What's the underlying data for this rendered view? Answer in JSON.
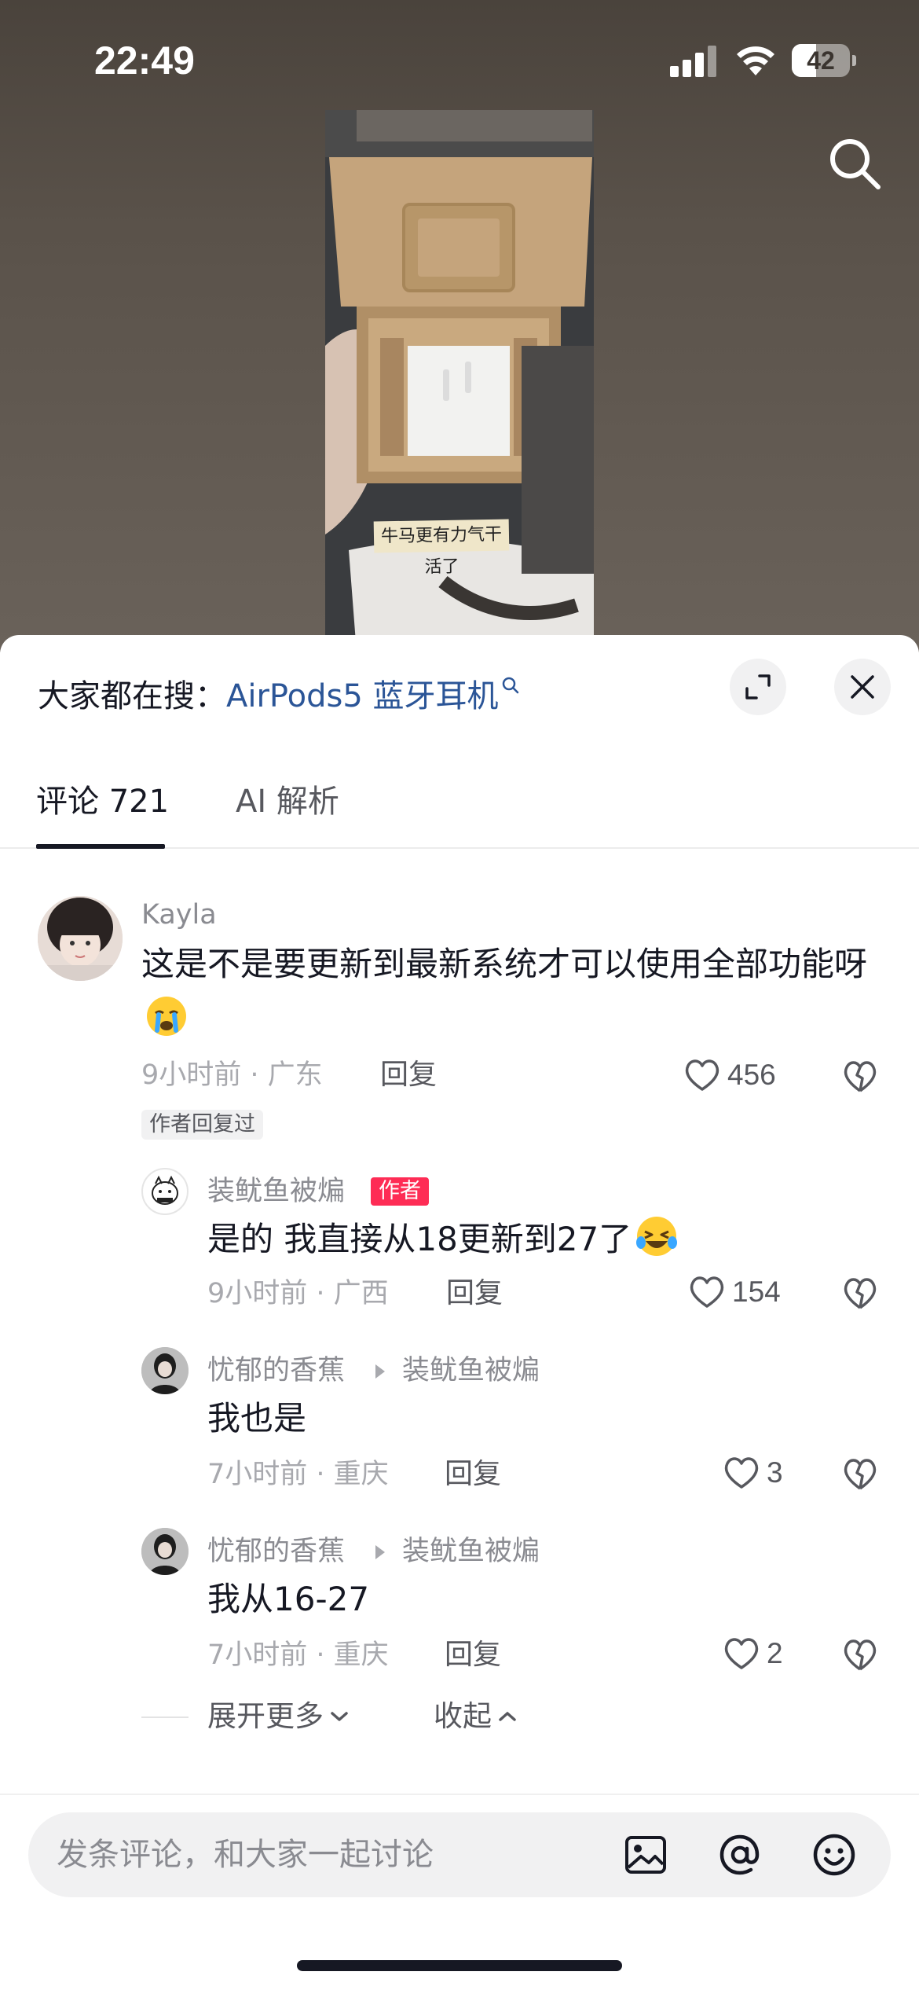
{
  "status_bar": {
    "time": "22:49",
    "battery": "42",
    "battery_level": 0.42
  },
  "video": {
    "note_text": "牛马更有力气干活了"
  },
  "sheet": {
    "trending_prefix": "大家都在搜：",
    "trending_query": "AirPods5 蓝牙耳机",
    "tabs": [
      {
        "label": "评论 721",
        "active": true
      },
      {
        "label": "AI 解析",
        "active": false
      }
    ]
  },
  "comments": {
    "main": {
      "username": "Kayla",
      "text": "这是不是要更新到最新系统才可以使用全部功能呀",
      "emoji": "crying-face",
      "meta": "9小时前 · 广东",
      "reply_label": "回复",
      "likes": "456",
      "badge": "作者回复过"
    },
    "replies": [
      {
        "username": "装鱿鱼被煸",
        "author_badge": "作者",
        "text": "是的 我直接从18更新到27了",
        "emoji": "laughing-tears-face",
        "meta": "9小时前 · 广西",
        "reply_label": "回复",
        "likes": "154"
      },
      {
        "username": "忧郁的香蕉",
        "reply_to": "装鱿鱼被煸",
        "text": "我也是",
        "meta": "7小时前 · 重庆",
        "reply_label": "回复",
        "likes": "3"
      },
      {
        "username": "忧郁的香蕉",
        "reply_to": "装鱿鱼被煸",
        "text": "我从16-27",
        "meta": "7小时前 · 重庆",
        "reply_label": "回复",
        "likes": "2"
      }
    ],
    "expand_more": "展开更多",
    "collapse": "收起"
  },
  "input": {
    "placeholder": "发条评论，和大家一起讨论"
  },
  "colors": {
    "accent_red": "#fe2c55",
    "link_blue": "#2b5597",
    "text_primary": "#161823",
    "text_secondary": "#8a8b91"
  },
  "icons": [
    "search-icon",
    "expand-icon",
    "close-icon",
    "heart-icon",
    "broken-heart-icon",
    "chevron-down-icon",
    "chevron-up-icon",
    "image-icon",
    "at-icon",
    "emoji-icon",
    "signal-icon",
    "wifi-icon",
    "battery-icon"
  ]
}
